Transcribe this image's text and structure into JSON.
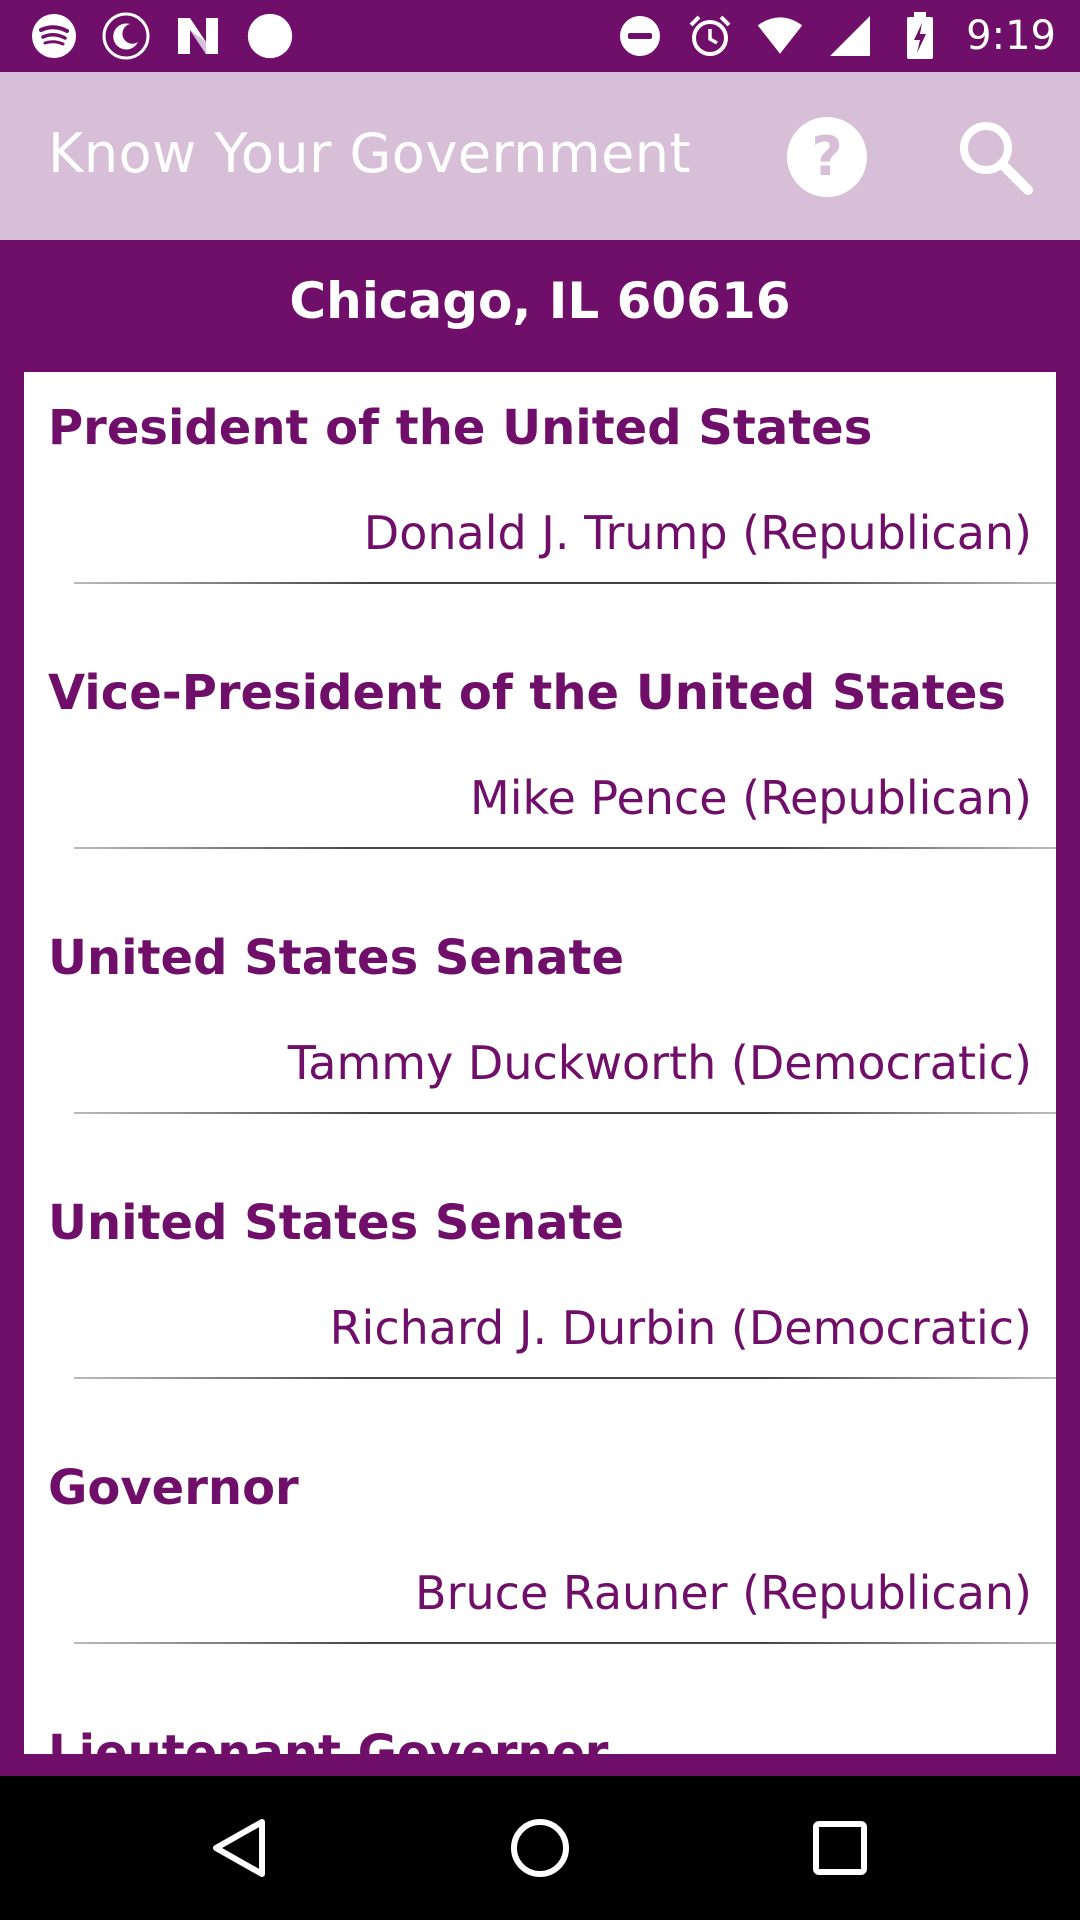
{
  "status_bar": {
    "time": "9:19",
    "left_icons": [
      "spotify-icon",
      "moon-icon",
      "n-icon",
      "circle-icon"
    ],
    "right_icons": [
      "dnd-icon",
      "alarm-icon",
      "wifi-icon",
      "signal-icon",
      "battery-charging-icon"
    ]
  },
  "app_bar": {
    "title": "Know Your Government",
    "help_icon": "help-icon",
    "search_icon": "search-icon"
  },
  "location": "Chicago, IL 60616",
  "offices": [
    {
      "office": "President of the United States",
      "official": "Donald J. Trump (Republican)"
    },
    {
      "office": "Vice-President of the United States",
      "official": "Mike Pence (Republican)"
    },
    {
      "office": "United States Senate",
      "official": "Tammy Duckworth (Democratic)"
    },
    {
      "office": "United States Senate",
      "official": "Richard J. Durbin (Democratic)"
    },
    {
      "office": "Governor",
      "official": "Bruce Rauner (Republican)"
    },
    {
      "office": "Lieutenant Governor",
      "official": ""
    }
  ],
  "colors": {
    "primary": "#6f0f69",
    "app_bar": "#d7bfd8",
    "card": "#ffffff"
  }
}
